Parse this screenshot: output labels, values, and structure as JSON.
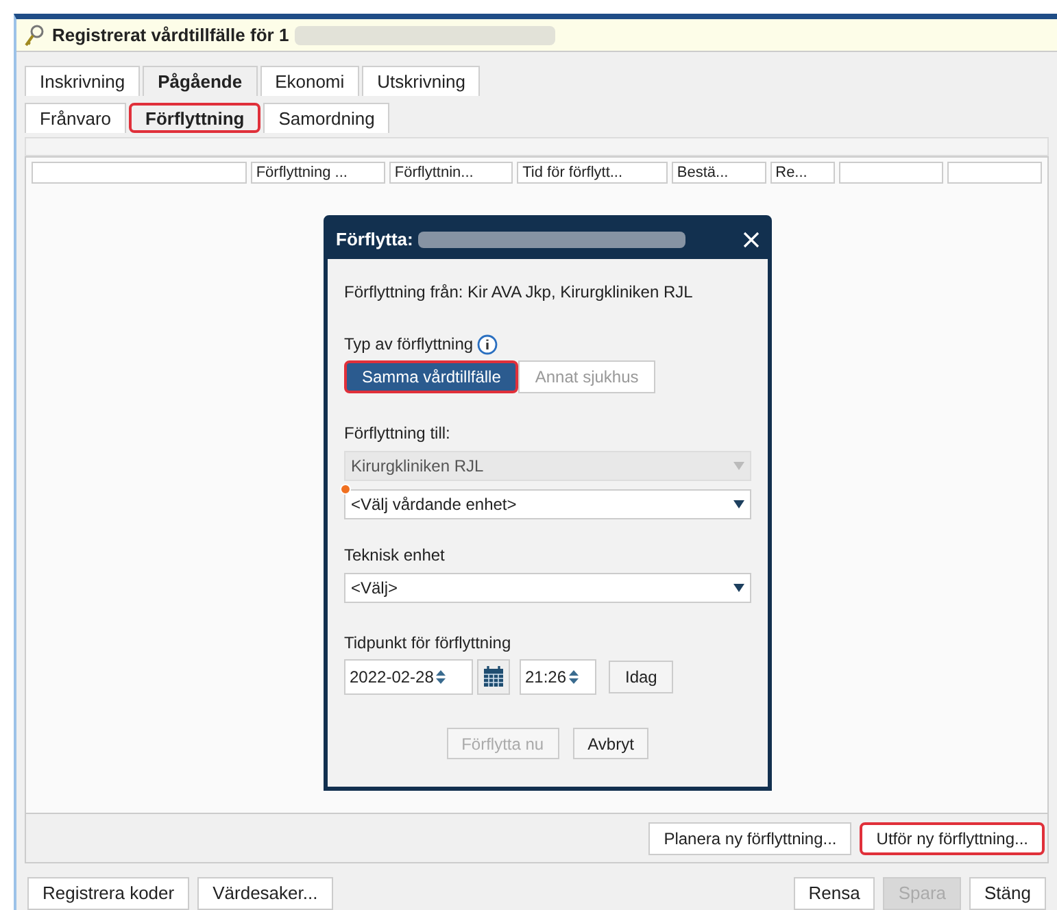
{
  "window": {
    "title": "Registrerat vårdtillfälle för 1"
  },
  "tabs": [
    {
      "label": "Inskrivning",
      "selected": false
    },
    {
      "label": "Pågående",
      "selected": true
    },
    {
      "label": "Ekonomi",
      "selected": false
    },
    {
      "label": "Utskrivning",
      "selected": false
    }
  ],
  "subtabs": [
    {
      "label": "Frånvaro",
      "selected": false,
      "highlighted": false
    },
    {
      "label": "Förflyttning",
      "selected": true,
      "highlighted": true
    },
    {
      "label": "Samordning",
      "selected": false,
      "highlighted": false
    }
  ],
  "table": {
    "columns": [
      "",
      "Förflyttning ...",
      "Förflyttnin...",
      "Tid för förflytt...",
      "Bestä...",
      "Re...",
      "",
      ""
    ]
  },
  "dialog": {
    "title": "Förflytta:",
    "from_text": "Förflyttning från: Kir AVA Jkp, Kirurgkliniken RJL",
    "type_label": "Typ av förflyttning",
    "type_options": [
      {
        "label": "Samma vårdtillfälle",
        "selected": true,
        "highlighted": true
      },
      {
        "label": "Annat sjukhus",
        "selected": false,
        "highlighted": false
      }
    ],
    "to_label": "Förflyttning till:",
    "to_clinic": {
      "value": "Kirurgkliniken RJL",
      "disabled": true
    },
    "to_unit": {
      "value": "<Välj vårdande enhet>",
      "required": true
    },
    "tech_label": "Teknisk enhet",
    "tech_unit": {
      "value": "<Välj>"
    },
    "time_label": "Tidpunkt för förflyttning",
    "date": "2022-02-28",
    "time": "21:26",
    "today_button": "Idag",
    "buttons": [
      {
        "label": "Förflytta nu",
        "disabled": true
      },
      {
        "label": "Avbryt",
        "disabled": false
      }
    ]
  },
  "action_buttons": [
    {
      "label": "Planera ny förflyttning...",
      "highlighted": false
    },
    {
      "label": "Utför ny förflyttning...",
      "highlighted": true
    }
  ],
  "footer_left_buttons": [
    {
      "label": "Registrera koder",
      "disabled": false
    },
    {
      "label": "Värdesaker...",
      "disabled": false
    }
  ],
  "footer_right_buttons": [
    {
      "label": "Rensa",
      "disabled": false
    },
    {
      "label": "Spara",
      "disabled": true
    },
    {
      "label": "Stäng",
      "disabled": false
    }
  ]
}
